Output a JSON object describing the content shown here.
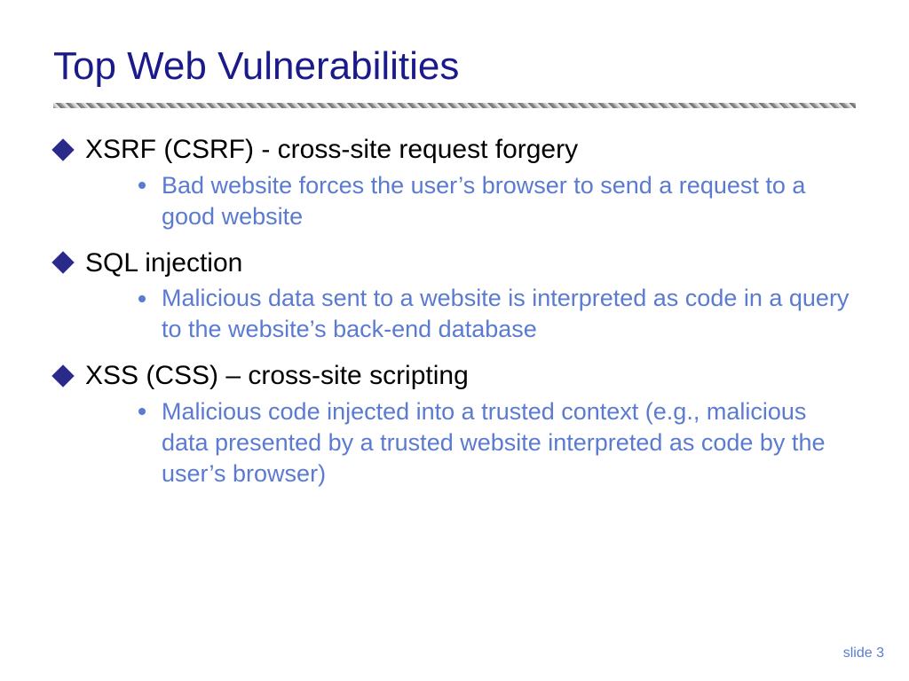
{
  "title": "Top Web Vulnerabilities",
  "items": [
    {
      "heading": "XSRF (CSRF) - cross-site request forgery",
      "detail": "Bad website forces the user’s browser to send a request to a good website"
    },
    {
      "heading": "SQL injection",
      "detail": "Malicious data sent to a website is interpreted as code in a query to the website’s back-end database"
    },
    {
      "heading": "XSS (CSS) – cross-site scripting",
      "detail": "Malicious code injected into a trusted context (e.g., malicious data presented by a trusted website interpreted as code by the user’s browser)"
    }
  ],
  "footer": "slide 3"
}
